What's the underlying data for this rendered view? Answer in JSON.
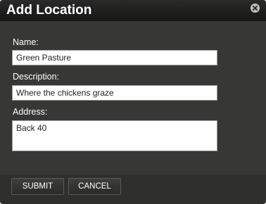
{
  "dialog": {
    "title": "Add Location",
    "close_icon": "close-icon"
  },
  "form": {
    "name_label": "Name:",
    "name_value": "Green Pasture",
    "description_label": "Description:",
    "description_value": "Where the chickens graze",
    "address_label": "Address:",
    "address_value": "Back 40"
  },
  "buttons": {
    "submit_label": "SUBMIT",
    "cancel_label": "CANCEL"
  },
  "colors": {
    "dialog_background": "#373836",
    "titlebar": "#1a1b19",
    "text": "#ffffff"
  }
}
